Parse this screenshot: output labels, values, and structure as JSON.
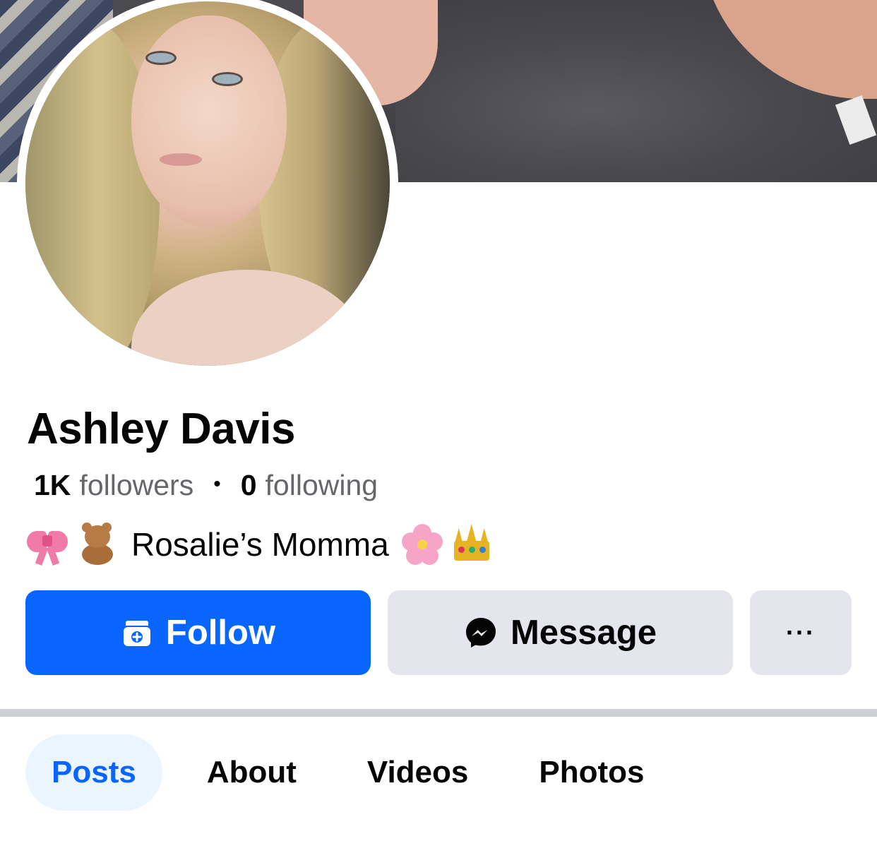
{
  "profile": {
    "name": "Ashley Davis",
    "followers_count": "1K",
    "followers_label": "followers",
    "separator": "•",
    "following_count": "0",
    "following_label": "following",
    "bio_text": "Rosalie’s Momma",
    "bio_emojis": [
      "ribbon-emoji",
      "teddy-bear-emoji",
      "cherry-blossom-emoji",
      "crown-emoji"
    ]
  },
  "actions": {
    "follow_label": "Follow",
    "message_label": "Message",
    "more_label": "···"
  },
  "tabs": [
    {
      "label": "Posts",
      "active": true
    },
    {
      "label": "About",
      "active": false
    },
    {
      "label": "Videos",
      "active": false
    },
    {
      "label": "Photos",
      "active": false
    }
  ],
  "colors": {
    "primary_blue": "#0866ff",
    "secondary_button": "#e4e6eb",
    "active_tab_bg": "#ebf5ff",
    "muted_text": "#65676b"
  }
}
